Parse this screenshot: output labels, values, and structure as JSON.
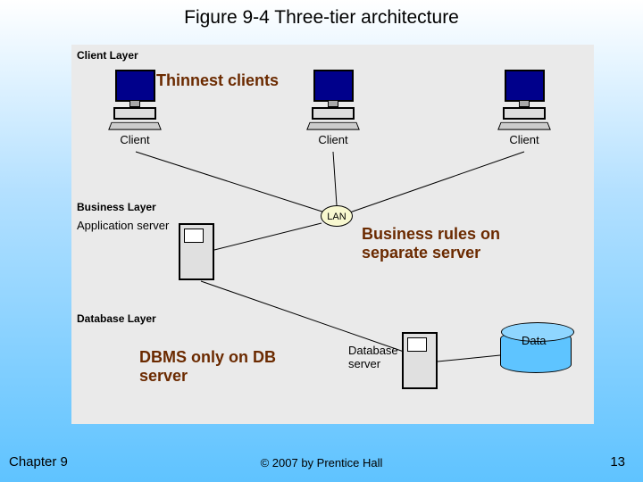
{
  "figure_title": "Figure 9-4 Three-tier architecture",
  "layers": {
    "client": "Client Layer",
    "business": "Business Layer",
    "database": "Database Layer"
  },
  "client_label": "Client",
  "lan": "LAN",
  "application_server": "Application server",
  "database_server": "Database server",
  "data": "Data",
  "callouts": {
    "thin": "Thinnest clients",
    "rules": "Business rules on separate server",
    "dbms": "DBMS only on DB server"
  },
  "footer": {
    "chapter": "Chapter 9",
    "copyright": "© 2007 by Prentice Hall",
    "page": "13"
  },
  "chart_data": {
    "type": "diagram",
    "title": "Figure 9-4 Three-tier architecture",
    "nodes": [
      {
        "id": "client1",
        "label": "Client",
        "layer": "Client Layer",
        "type": "client-pc"
      },
      {
        "id": "client2",
        "label": "Client",
        "layer": "Client Layer",
        "type": "client-pc"
      },
      {
        "id": "client3",
        "label": "Client",
        "layer": "Client Layer",
        "type": "client-pc"
      },
      {
        "id": "lan",
        "label": "LAN",
        "layer": "Business Layer",
        "type": "network"
      },
      {
        "id": "app_server",
        "label": "Application server",
        "layer": "Business Layer",
        "type": "server"
      },
      {
        "id": "db_server",
        "label": "Database server",
        "layer": "Database Layer",
        "type": "server"
      },
      {
        "id": "data",
        "label": "Data",
        "layer": "Database Layer",
        "type": "datastore"
      }
    ],
    "edges": [
      {
        "from": "client1",
        "to": "lan"
      },
      {
        "from": "client2",
        "to": "lan"
      },
      {
        "from": "client3",
        "to": "lan"
      },
      {
        "from": "lan",
        "to": "app_server"
      },
      {
        "from": "app_server",
        "to": "db_server"
      },
      {
        "from": "db_server",
        "to": "data"
      }
    ],
    "annotations": [
      {
        "text": "Thinnest clients",
        "targets": [
          "client1",
          "client2",
          "client3"
        ]
      },
      {
        "text": "Business rules on separate server",
        "targets": [
          "app_server"
        ]
      },
      {
        "text": "DBMS only on DB server",
        "targets": [
          "db_server"
        ]
      }
    ]
  }
}
